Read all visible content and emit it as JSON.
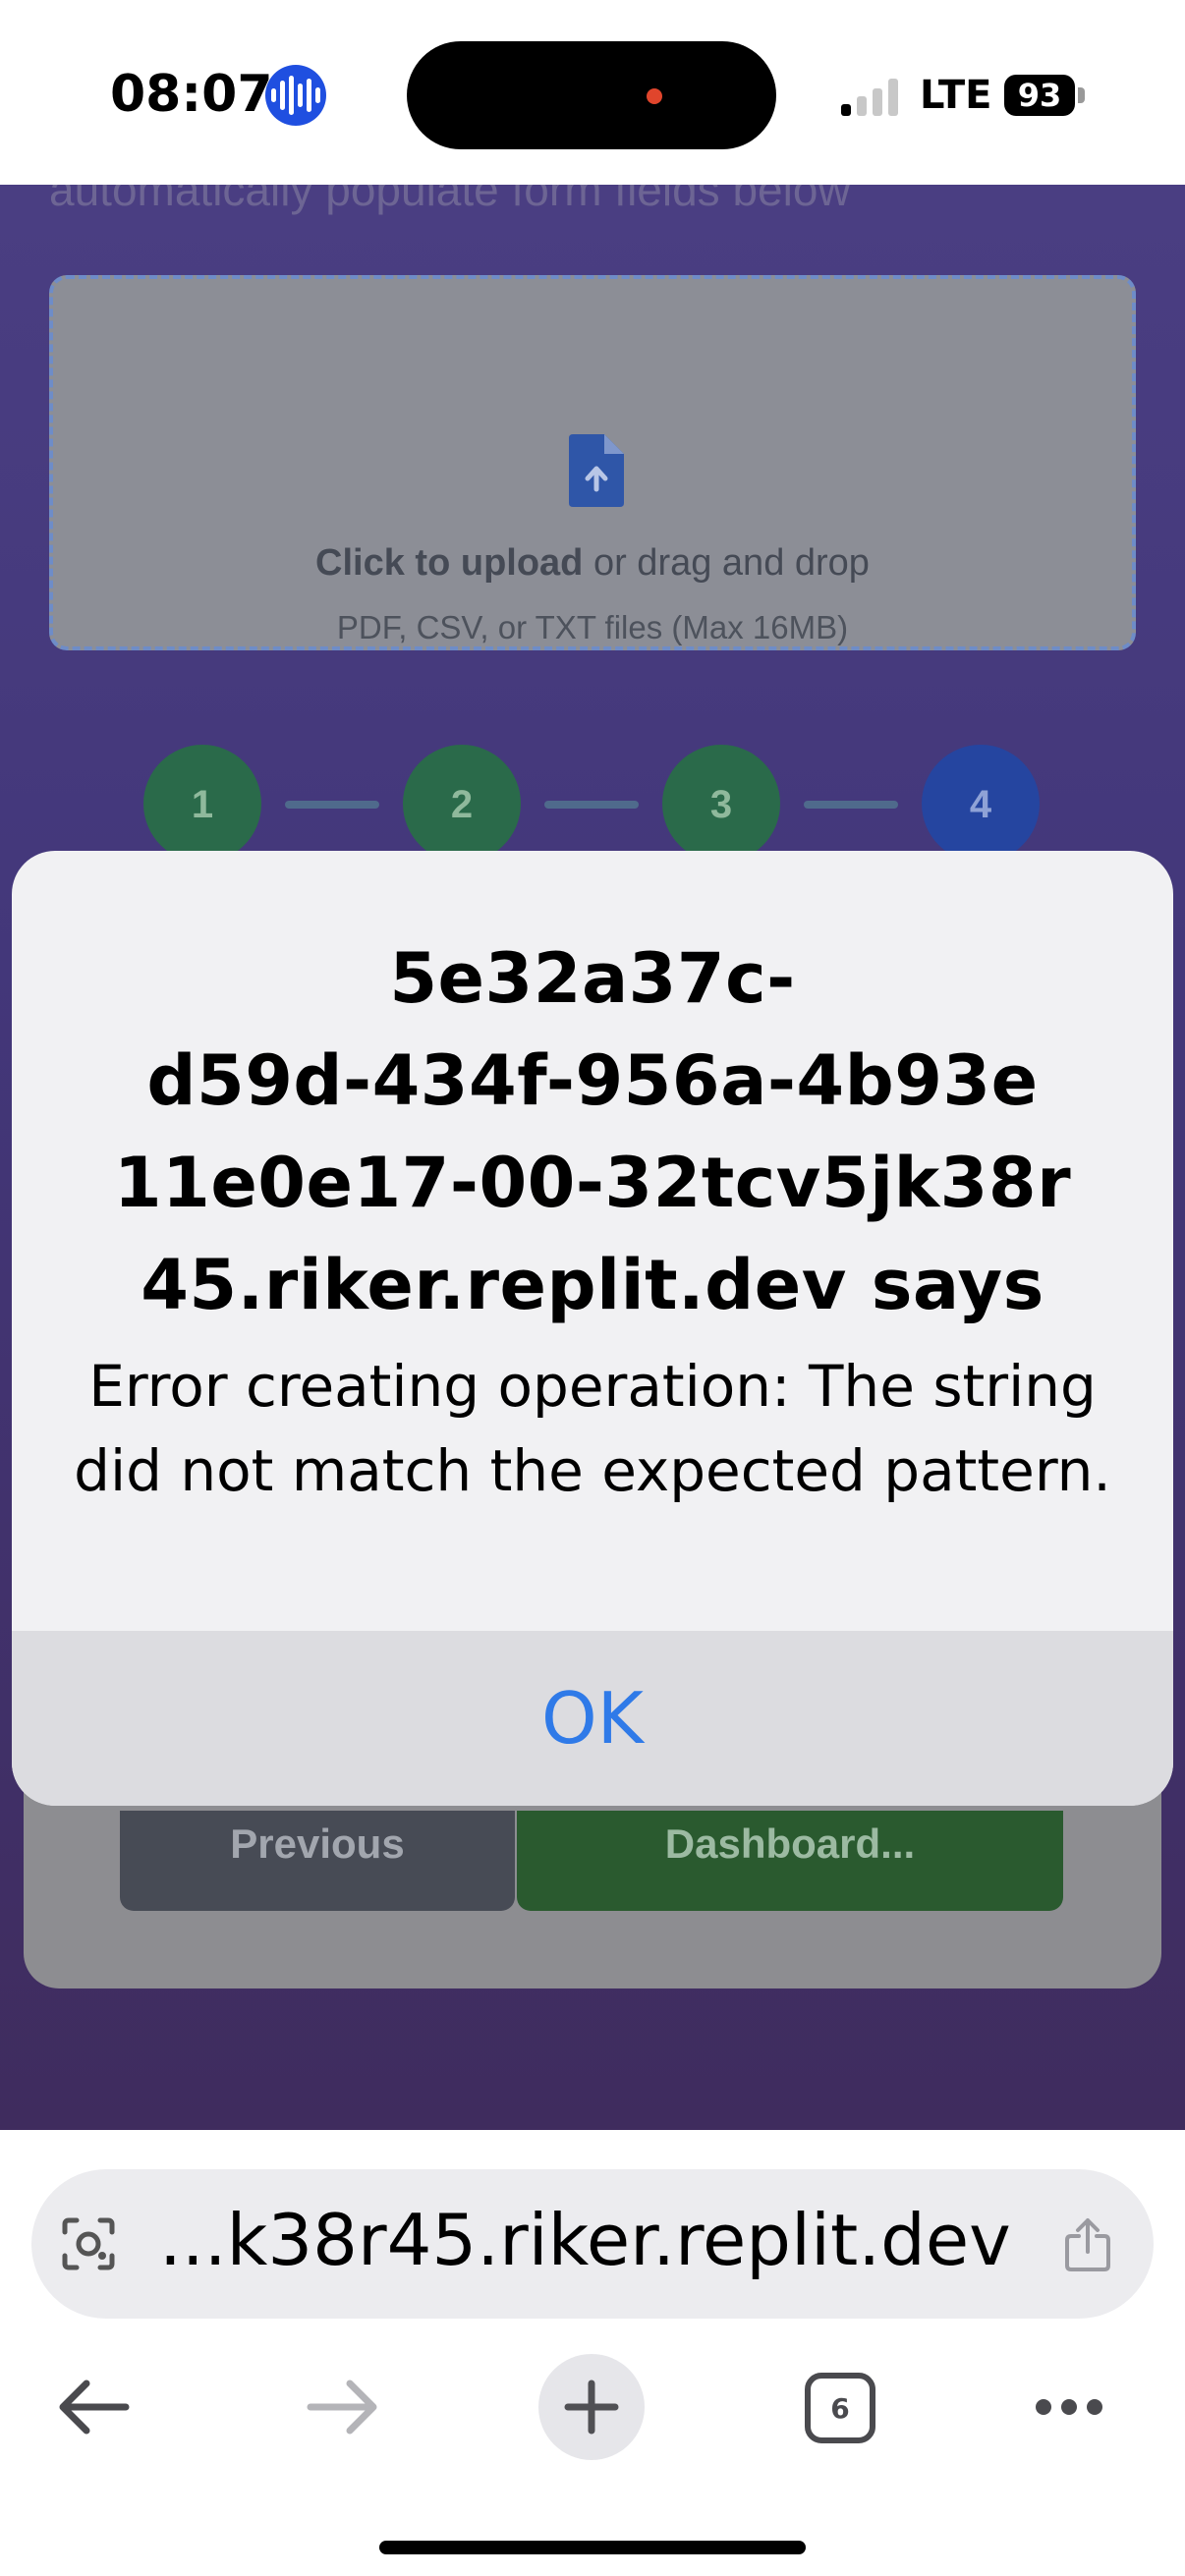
{
  "status_bar": {
    "time": "08:07",
    "network": "LTE",
    "battery": "93",
    "signal_bars_on": 1,
    "signal_bars_total": 4
  },
  "page": {
    "cut_text": "automatically populate form fields below",
    "upload": {
      "main_bold": "Click to upload",
      "main_rest": " or drag and drop",
      "sub": "PDF, CSV, or TXT files (Max 16MB)"
    },
    "steps": [
      {
        "label": "1",
        "state": "done"
      },
      {
        "label": "2",
        "state": "done"
      },
      {
        "label": "3",
        "state": "done"
      },
      {
        "label": "4",
        "state": "current"
      }
    ],
    "previous_label": "Previous",
    "dashboard_label": "Dashboard..."
  },
  "alert": {
    "title_lines": [
      "5e32a37c-",
      "d59d-434f-956a-4b93e",
      "11e0e17-00-32tcv5jk38r",
      "45.riker.replit.dev says"
    ],
    "message": "Error creating operation: The string did not match the expected pattern.",
    "ok_label": "OK"
  },
  "browser": {
    "url": "...k38r45.riker.replit.dev",
    "tab_count": "6"
  },
  "colors": {
    "accent_blue": "#2f7ae8",
    "step_done": "#2a6a4a",
    "step_current": "#2545a0",
    "voice_indicator": "#1f4fe0"
  },
  "icons": {
    "upload": "file-upload-icon",
    "page_menu": "page-settings-icon",
    "share": "share-icon",
    "back": "back-arrow-icon",
    "forward": "forward-arrow-icon",
    "new_tab": "plus-icon",
    "tabs": "tabs-icon",
    "more": "more-icon"
  }
}
